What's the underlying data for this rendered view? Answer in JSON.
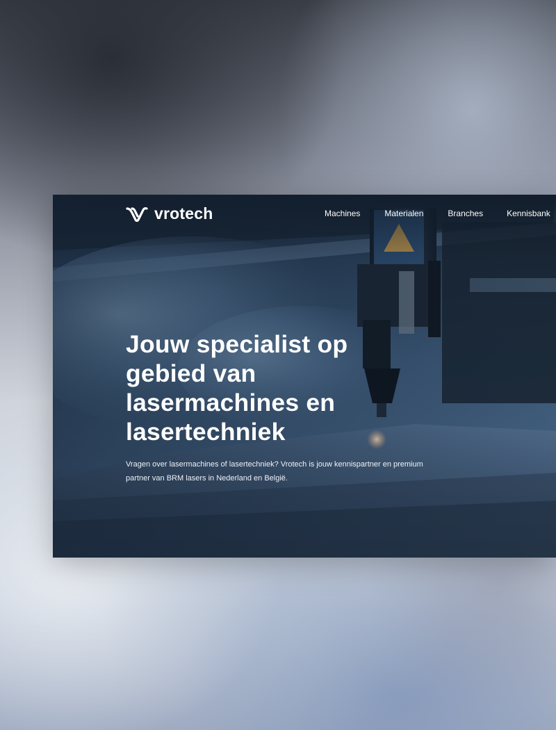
{
  "brand": {
    "name": "vrotech",
    "logo_icon": "v-logo-icon"
  },
  "nav": {
    "items": [
      {
        "label": "Machines"
      },
      {
        "label": "Materialen"
      },
      {
        "label": "Branches"
      },
      {
        "label": "Kennisbank"
      }
    ]
  },
  "hero": {
    "headline": "Jouw specialist op gebied van lasermachines en lasertechniek",
    "lead": "Vragen over lasermachines of lasertechniek? Vrotech is jouw kennispartner en premium partner van BRM lasers in Nederland en België."
  },
  "colors": {
    "text": "#ffffff",
    "hero_dark": "#1b2a3a",
    "hero_blue": "#4c6b8c"
  }
}
